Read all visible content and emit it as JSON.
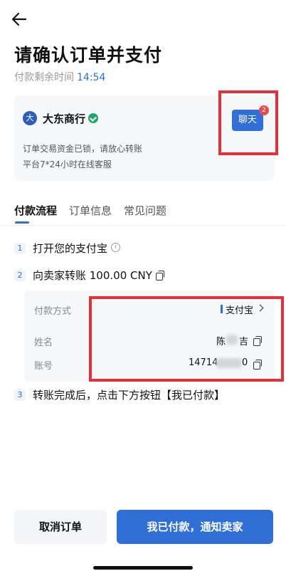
{
  "header": {
    "back_icon": "arrow-left-icon",
    "title": "请确认订单并支付",
    "timer_label": "付款剩余时间",
    "timer_value": "14:54"
  },
  "merchant": {
    "avatar_text": "大",
    "name": "大东商行",
    "verified_icon": "verified-badge-icon",
    "line1": "订单交易资金已锁，请放心转账",
    "line2": "平台7*24小时在线客服",
    "chat_label": "聊天",
    "chat_badge": "2"
  },
  "tabs": [
    {
      "label": "付款流程",
      "active": true
    },
    {
      "label": "订单信息",
      "active": false
    },
    {
      "label": "常见问题",
      "active": false
    }
  ],
  "steps": [
    {
      "num": "1",
      "text": "打开您的支付宝"
    },
    {
      "num": "2",
      "text": "向卖家转账 100.00 CNY"
    },
    {
      "num": "3",
      "text": "转账完成后，点击下方按钮【我已付款】"
    }
  ],
  "info_icon": "i",
  "payment": {
    "method_label": "付款方式",
    "method_value": "支付宝",
    "name_label": "姓名",
    "name_visible": "陈",
    "name_visible_tail": "吉",
    "account_label": "账号",
    "account_prefix": "14714",
    "account_suffix": "0"
  },
  "footer": {
    "cancel_label": "取消订单",
    "notify_label": "我已付款，通知卖家"
  },
  "colors": {
    "accent": "#2f6fd6",
    "highlight_box": "#e5303a",
    "badge": "#e84b4b"
  }
}
